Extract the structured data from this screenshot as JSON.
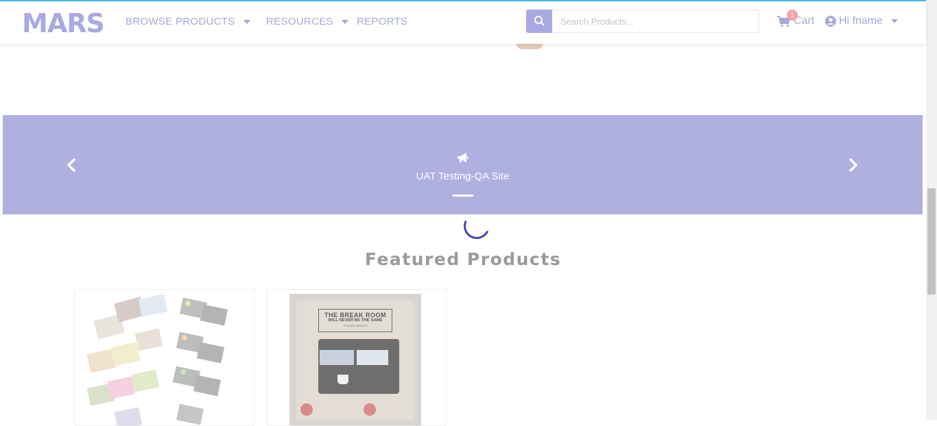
{
  "brand": {
    "logo": "MARS"
  },
  "nav": {
    "browse": "BROWSE PRODUCTS",
    "resources": "RESOURCES",
    "reports": "REPORTS"
  },
  "search": {
    "placeholder": "Search Products..."
  },
  "cart": {
    "label": "Cart",
    "count": "1"
  },
  "user": {
    "greeting": "Hi fname"
  },
  "banner": {
    "title": "UAT Testing-QA Site"
  },
  "section": {
    "title": "Featured Products"
  },
  "product2": {
    "headline1": "THE BREAK ROOM",
    "headline2": "WILL NEVER BE THE SAME",
    "sub": "FLAVIA® BARISTA"
  },
  "colors": {
    "accent": "#a9a9e2",
    "banner": "#b0b0e0",
    "spinner": "#4244b2",
    "badge": "#f4a3a3"
  }
}
